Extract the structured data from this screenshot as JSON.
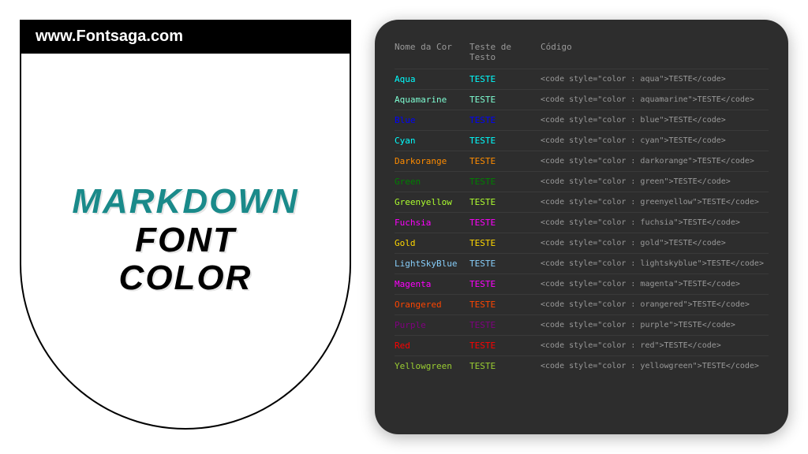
{
  "url": "www.Fontsaga.com",
  "title": {
    "line1": "MARKDOWN",
    "line2": "FONT",
    "line3": "COLOR"
  },
  "table": {
    "headers": {
      "name": "Nome da Cor",
      "test": "Teste de Testo",
      "code": "Código"
    },
    "rows": [
      {
        "name": "Aqua",
        "test": "TESTE",
        "color": "#00ffff",
        "code": "<code style=\"color : aqua\">TESTE</code>"
      },
      {
        "name": "Aquamarine",
        "test": "TESTE",
        "color": "#7fffd4",
        "code": "<code style=\"color : aquamarine\">TESTE</code>"
      },
      {
        "name": "Blue",
        "test": "TESTE",
        "color": "#0000ff",
        "code": "<code style=\"color : blue\">TESTE</code>"
      },
      {
        "name": "Cyan",
        "test": "TESTE",
        "color": "#00ffff",
        "code": "<code style=\"color : cyan\">TESTE</code>"
      },
      {
        "name": "Darkorange",
        "test": "TESTE",
        "color": "#ff8c00",
        "code": "<code style=\"color : darkorange\">TESTE</code>"
      },
      {
        "name": "Green",
        "test": "TESTE",
        "color": "#008000",
        "code": "<code style=\"color : green\">TESTE</code>"
      },
      {
        "name": "Greenyellow",
        "test": "TESTE",
        "color": "#adff2f",
        "code": "<code style=\"color : greenyellow\">TESTE</code>"
      },
      {
        "name": "Fuchsia",
        "test": "TESTE",
        "color": "#ff00ff",
        "code": "<code style=\"color : fuchsia\">TESTE</code>"
      },
      {
        "name": "Gold",
        "test": "TESTE",
        "color": "#ffd700",
        "code": "<code style=\"color : gold\">TESTE</code>"
      },
      {
        "name": "LightSkyBlue",
        "test": "TESTE",
        "color": "#87cefa",
        "code": "<code style=\"color : lightskyblue\">TESTE</code>"
      },
      {
        "name": "Magenta",
        "test": "TESTE",
        "color": "#ff00ff",
        "code": "<code style=\"color : magenta\">TESTE</code>"
      },
      {
        "name": "Orangered",
        "test": "TESTE",
        "color": "#ff4500",
        "code": "<code style=\"color : orangered\">TESTE</code>"
      },
      {
        "name": "Purple",
        "test": "TESTE",
        "color": "#800080",
        "code": "<code style=\"color : purple\">TESTE</code>"
      },
      {
        "name": "Red",
        "test": "TESTE",
        "color": "#ff0000",
        "code": "<code style=\"color : red\">TESTE</code>"
      },
      {
        "name": "Yellowgreen",
        "test": "TESTE",
        "color": "#9acd32",
        "code": "<code style=\"color : yellowgreen\">TESTE</code>"
      }
    ]
  }
}
